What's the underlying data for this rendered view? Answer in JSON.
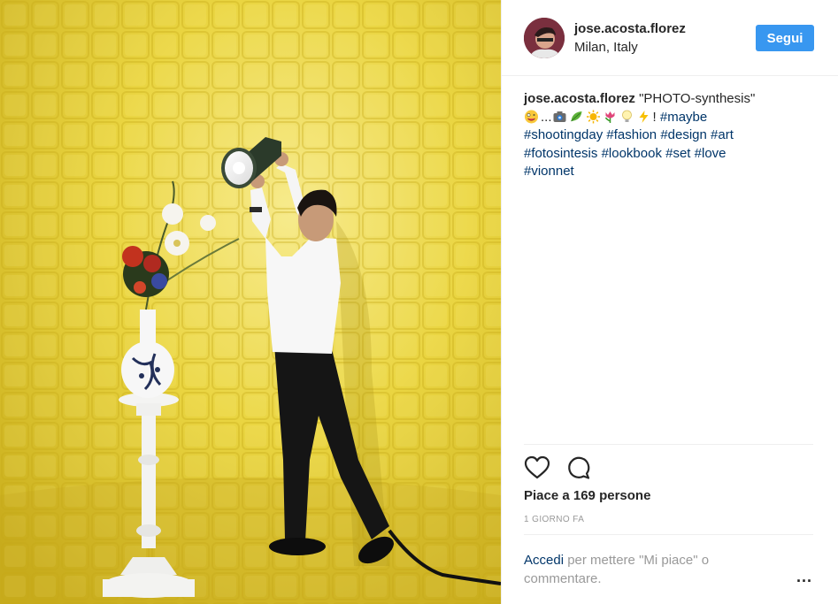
{
  "post": {
    "photo_alt": "",
    "user": {
      "username": "jose.acosta.florez",
      "location": "Milan, Italy",
      "follow_label": "Segui"
    },
    "caption": {
      "author": "jose.acosta.florez",
      "title": "\"PHOTO-synthesis\"",
      "ellipsis": "...",
      "exclaim": "!",
      "hashtags": [
        "#maybe",
        "#shootingday",
        "#fashion",
        "#design",
        "#art",
        "#fotosintesis",
        "#lookbook",
        "#set",
        "#love",
        "#vionnet"
      ],
      "emojis": [
        "crazy-face-emoji",
        "camera-emoji",
        "leaf-emoji",
        "sun-emoji",
        "tulip-emoji",
        "light-bulb-emoji",
        "lightning-emoji"
      ]
    },
    "likes_text": "Piace a 169 persone",
    "time_text": "1 GIORNO FA",
    "login_link": "Accedi",
    "login_rest": " per mettere \"Mi piace\" o commentare.",
    "more_label": "..."
  },
  "colors": {
    "follow_button": "#3897f0",
    "link": "#003569",
    "muted": "#999999",
    "background_yellow": "#e9cf33"
  }
}
